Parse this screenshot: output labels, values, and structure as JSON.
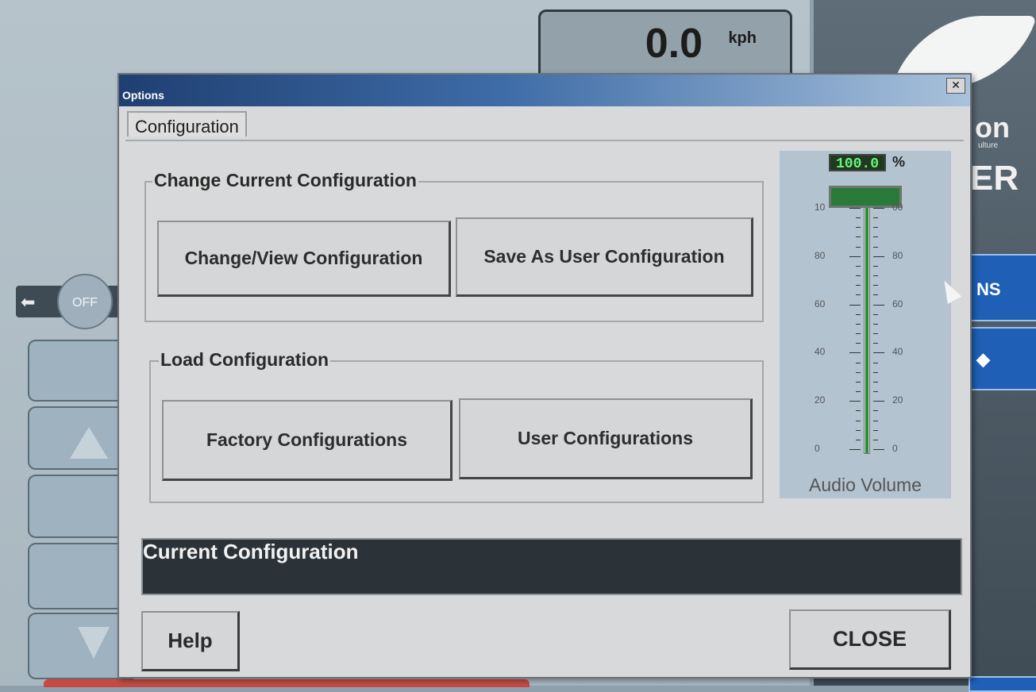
{
  "background": {
    "speed": {
      "value": "0.0",
      "unit": "kph"
    },
    "brand": {
      "line1": "on",
      "line2": "ulture",
      "line3": "ER"
    },
    "side_buttons": [
      "NS",
      "◆"
    ],
    "off_label": "OFF",
    "arrow_left": "⬅"
  },
  "dialog": {
    "title": "Options",
    "close_glyph": "✕",
    "tab_label": "Configuration",
    "change_group": {
      "title": "Change Current Configuration",
      "change_view_label": "Change/View Configuration",
      "save_as_label": "Save As User Configuration"
    },
    "load_group": {
      "title": "Load Configuration",
      "factory_label": "Factory Configurations",
      "user_label": "User Configurations"
    },
    "volume": {
      "readout": "100.0",
      "unit": "%",
      "level_percent": 100,
      "ticks_left": [
        "10",
        "80",
        "60",
        "40",
        "20",
        "0"
      ],
      "ticks_right": [
        "00",
        "80",
        "60",
        "40",
        "20",
        "0"
      ],
      "label": "Audio Volume"
    },
    "current_configuration": {
      "label": "Current Configuration",
      "value": ""
    },
    "help_label": "Help",
    "close_label": "CLOSE"
  },
  "colors": {
    "titlebar_start": "#1f3f72",
    "current_bg": "#2c3338",
    "volume_green": "#2c8a3a",
    "side_blue": "#1f5fb5"
  }
}
